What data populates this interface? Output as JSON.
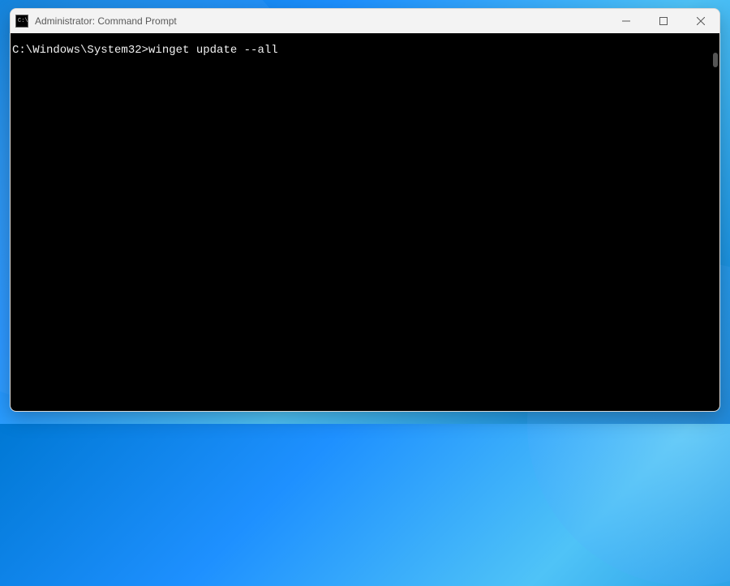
{
  "window": {
    "title": "Administrator: Command Prompt",
    "app_icon_label": "C:\\"
  },
  "terminal": {
    "prompt": "C:\\Windows\\System32>",
    "command": "winget update --all"
  },
  "controls": {
    "minimize": "Minimize",
    "maximize": "Maximize",
    "close": "Close"
  }
}
